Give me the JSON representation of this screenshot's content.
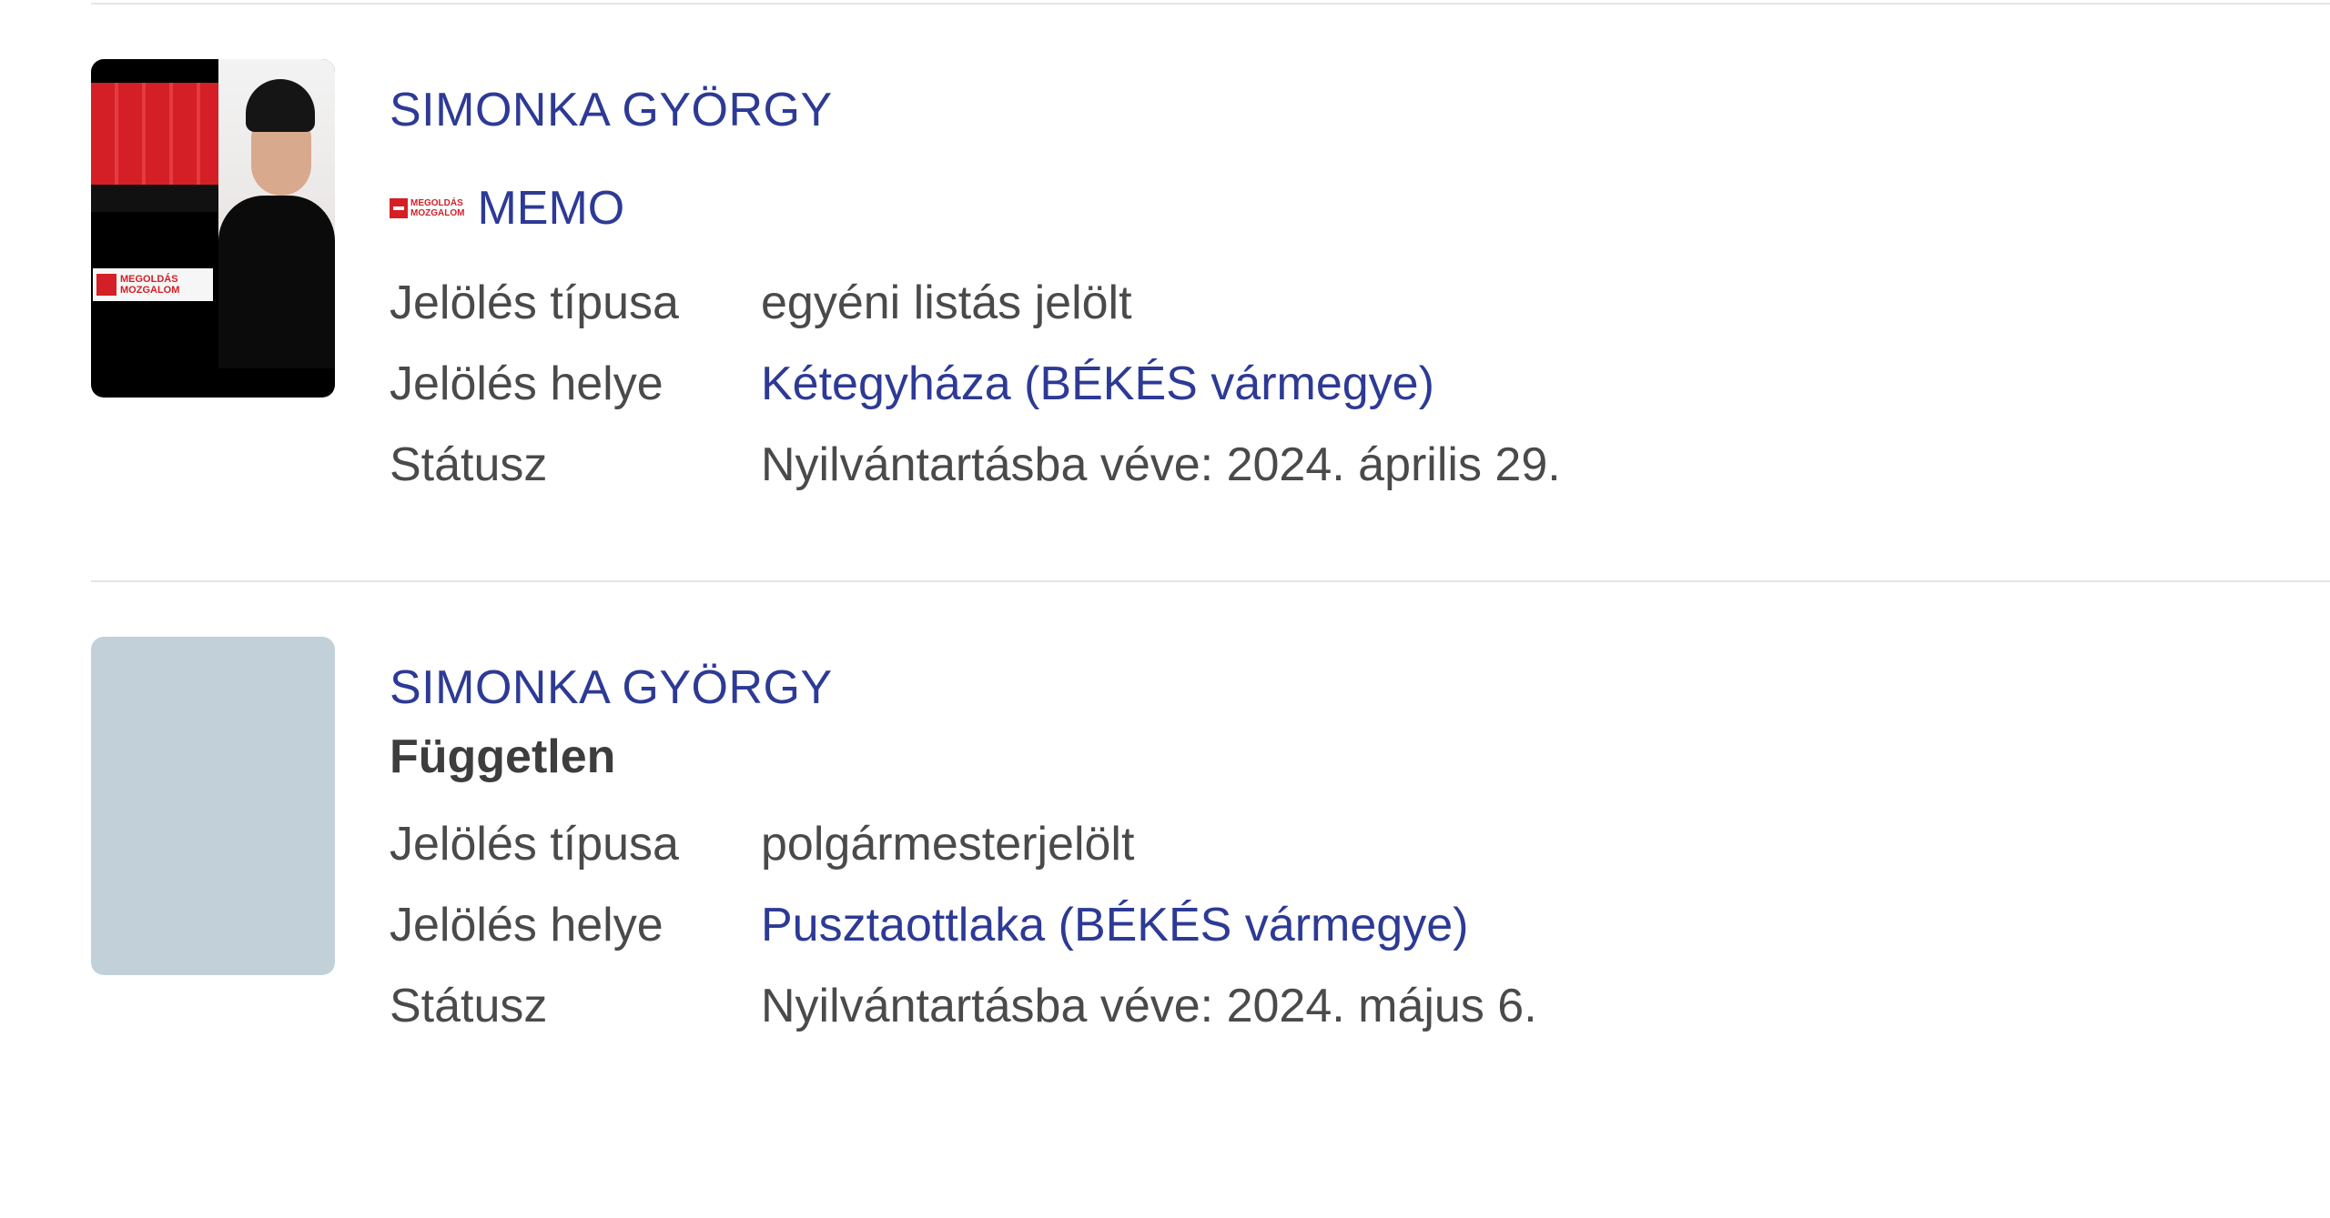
{
  "candidates": [
    {
      "name": "SIMONKA GYÖRGY",
      "party": {
        "logo_text": "MEGOLDÁS\nMOZGALOM",
        "name": "MEMO",
        "color": "#d41f26"
      },
      "photo": {
        "badge_text": "MEGOLDÁS\nMOZGALOM"
      },
      "details": {
        "type_label": "Jelölés típusa",
        "type_value": "egyéni listás jelölt",
        "place_label": "Jelölés helye",
        "place_value": "Kétegyháza (BÉKÉS vármegye)",
        "status_label": "Státusz",
        "status_value": "Nyilvántartásba véve: 2024. április 29."
      }
    },
    {
      "name": "SIMONKA GYÖRGY",
      "party": {
        "name": "Független"
      },
      "details": {
        "type_label": "Jelölés típusa",
        "type_value": "polgármesterjelölt",
        "place_label": "Jelölés helye",
        "place_value": "Pusztaottlaka (BÉKÉS vármegye)",
        "status_label": "Státusz",
        "status_value": "Nyilvántartásba véve: 2024. május 6."
      }
    }
  ],
  "colors": {
    "link": "#2d3a95",
    "text": "#4a4a4a",
    "placeholder": "#c2d1d9",
    "divider": "#e2e5e8"
  }
}
